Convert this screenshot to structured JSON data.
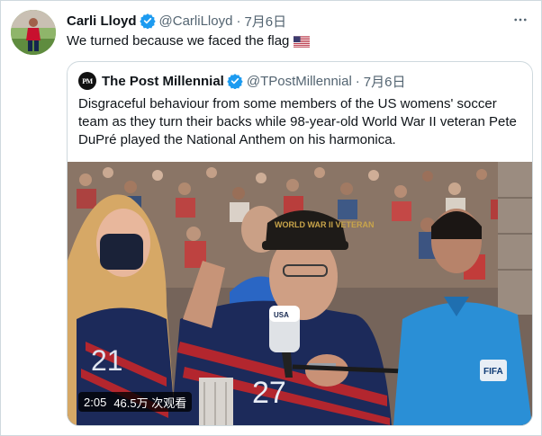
{
  "tweet": {
    "author_name": "Carli Lloyd",
    "author_handle": "@CarliLloyd",
    "separator": "·",
    "date": "7月6日",
    "text": "We turned because we faced the flag",
    "text_emoji": "us-flag-icon",
    "avatar": "player-photo"
  },
  "quoted_tweet": {
    "author_name": "The Post Millennial",
    "author_handle": "@TPostMillennial",
    "separator": "·",
    "date": "7月6日",
    "avatar_label": "PM",
    "text": "Disgraceful behaviour from some members of the US womens' soccer team as they turn their backs while 98-year-old World War II veteran Pete DuPré played the National Anthem on his harmonica."
  },
  "video": {
    "duration": "2:05",
    "views": "46.5万 次观看",
    "scene_text": {
      "cap_text": "WORLD WAR II VETERAN",
      "mic_label": "USA",
      "jersey_number_left": "21",
      "jersey_number_center": "27",
      "referee_badge": "FIFA"
    }
  },
  "colors": {
    "verified": "#1d9bf0",
    "muted_text": "#536471",
    "border": "#cfd9de",
    "jersey_navy": "#1c2a5a",
    "jersey_red": "#b3262e",
    "referee_blue": "#2a8fd6"
  }
}
